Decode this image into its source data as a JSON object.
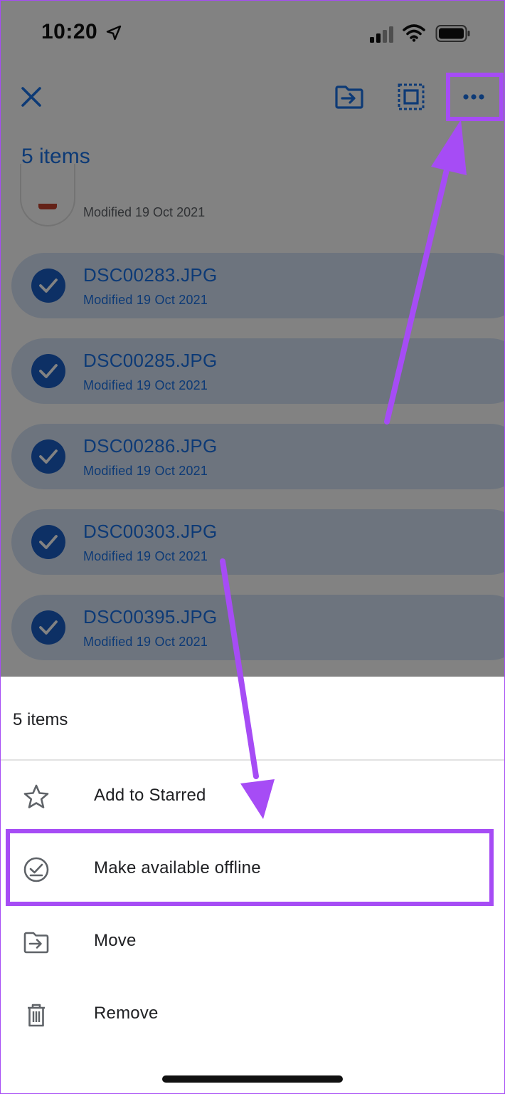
{
  "status_bar": {
    "time": "10:20"
  },
  "header": {
    "title": "5 items"
  },
  "partial_item": {
    "subtitle": "Modified 19 Oct 2021"
  },
  "files": [
    {
      "name": "DSC00283.JPG",
      "modified": "Modified 19 Oct 2021"
    },
    {
      "name": "DSC00285.JPG",
      "modified": "Modified 19 Oct 2021"
    },
    {
      "name": "DSC00286.JPG",
      "modified": "Modified 19 Oct 2021"
    },
    {
      "name": "DSC00303.JPG",
      "modified": "Modified 19 Oct 2021"
    },
    {
      "name": "DSC00395.JPG",
      "modified": "Modified 19 Oct 2021"
    }
  ],
  "sheet": {
    "title": "5 items",
    "items": [
      {
        "label": "Add to Starred",
        "icon": "star-icon"
      },
      {
        "label": "Make available offline",
        "icon": "offline-icon"
      },
      {
        "label": "Move",
        "icon": "move-icon"
      },
      {
        "label": "Remove",
        "icon": "trash-icon"
      }
    ]
  },
  "colors": {
    "accent": "#1a73e8",
    "selected_row": "#d6e4f8",
    "annotation": "#a64cf5"
  }
}
